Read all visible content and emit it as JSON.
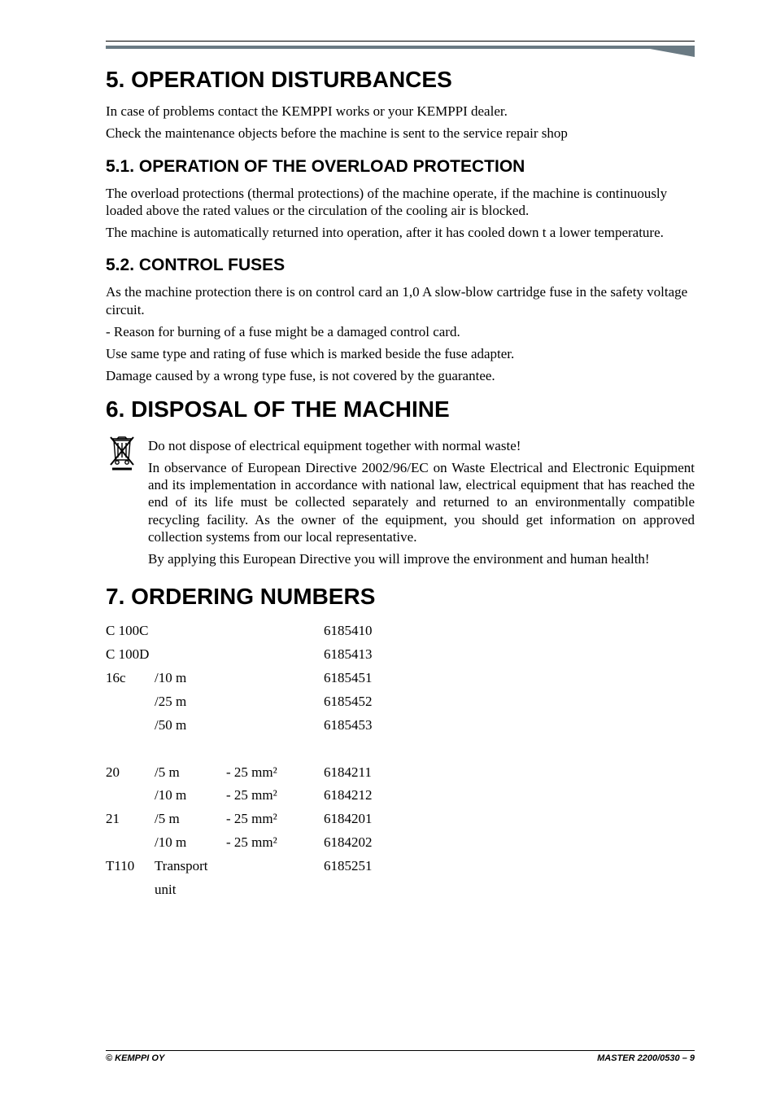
{
  "sections": {
    "s5": {
      "title": "5. OPERATION DISTURBANCES",
      "p1": "In case of problems contact the KEMPPI works or your KEMPPI dealer.",
      "p2": "Check the maintenance objects before the machine is sent to the service repair shop",
      "s51": {
        "title": "5.1. OPERATION OF THE OVERLOAD PROTECTION",
        "p1": "The overload protections (thermal protections) of the machine operate, if the machine is continuously loaded above the rated values or the circulation of the cooling air is blocked.",
        "p2": "The machine is automatically returned into operation, after it has cooled down t a lower temperature."
      },
      "s52": {
        "title": "5.2. CONTROL FUSES",
        "p1": "As the machine protection there is on control card an 1,0 A slow-blow cartridge fuse in the safety voltage circuit.",
        "p2": "-  Reason for burning of a fuse might be a damaged control card.",
        "p3": "Use same type and rating of fuse which is marked beside the fuse adapter.",
        "p4": "Damage caused by a wrong type fuse, is not covered by the guarantee."
      }
    },
    "s6": {
      "title": "6. DISPOSAL OF THE MACHINE",
      "p1": "Do not dispose of electrical equipment together with normal waste!",
      "p2": "In observance of European Directive 2002/96/EC on Waste Electrical and Electronic Equipment and its implementation in accordance with national law, electrical equipment that has reached the end of its life must be collected separately and returned to an environmentally compatible recycling facility. As the owner of the equipment, you should get information on approved collection systems from our local representative.",
      "p3": "By applying this European Directive you will improve the environment and human health!"
    },
    "s7": {
      "title": "7. ORDERING NUMBERS",
      "rows": [
        {
          "c1": "C 100C",
          "c2": "",
          "c3": "",
          "c4": "6185410"
        },
        {
          "c1": "C 100D",
          "c2": "",
          "c3": "",
          "c4": "6185413"
        },
        {
          "c1": "16c",
          "c2": "/10 m",
          "c3": "",
          "c4": "6185451"
        },
        {
          "c1": "",
          "c2": "/25 m",
          "c3": "",
          "c4": "6185452"
        },
        {
          "c1": "",
          "c2": "/50 m",
          "c3": "",
          "c4": "6185453"
        },
        {
          "c1": "",
          "c2": "",
          "c3": "",
          "c4": ""
        },
        {
          "c1": "20",
          "c2": "/5 m",
          "c3": "- 25 mm²",
          "c4": "6184211"
        },
        {
          "c1": "",
          "c2": "/10 m",
          "c3": "- 25 mm²",
          "c4": "6184212"
        },
        {
          "c1": "21",
          "c2": "/5 m",
          "c3": "- 25 mm²",
          "c4": "6184201"
        },
        {
          "c1": "",
          "c2": "/10 m",
          "c3": "- 25 mm²",
          "c4": "6184202"
        },
        {
          "c1": "T110",
          "c2": "Transport unit",
          "c3": "",
          "c4": "6185251"
        }
      ]
    }
  },
  "footer": {
    "left": "© KEMPPI OY",
    "right": "MASTER 2200/0530 – 9"
  }
}
